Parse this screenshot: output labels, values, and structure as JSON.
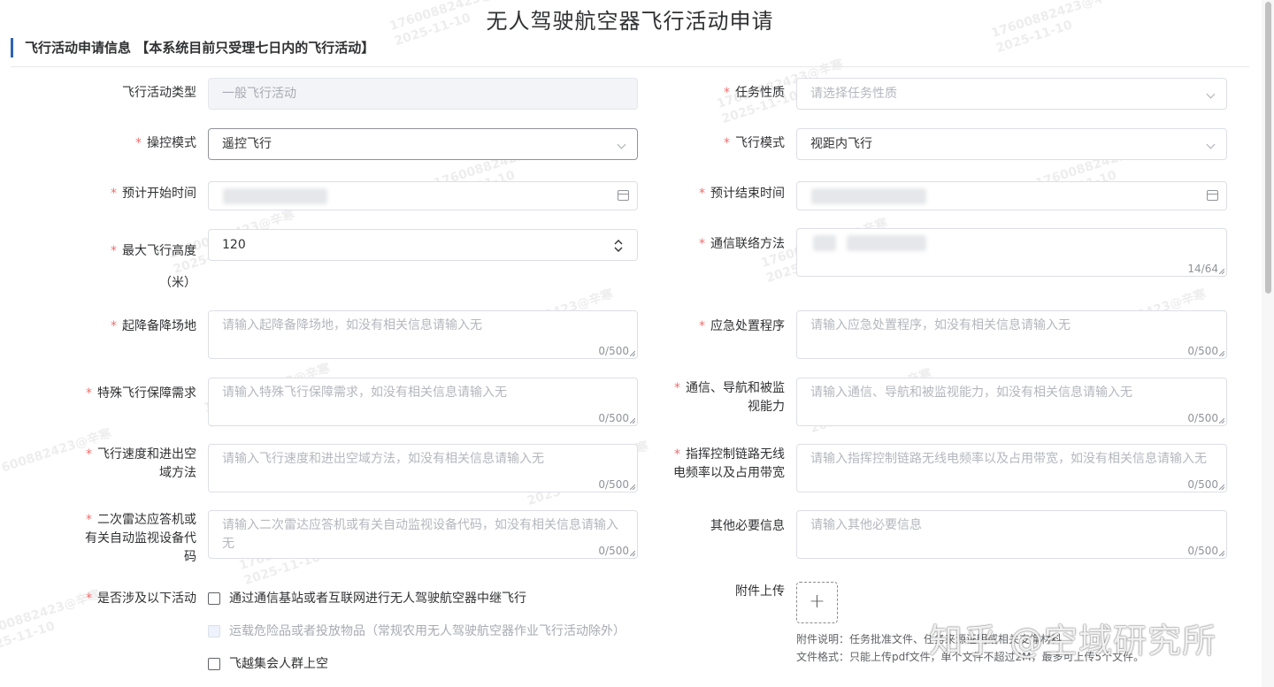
{
  "page_title": "无人驾驶航空器飞行活动申请",
  "section_title": "飞行活动申请信息 【本系统目前只受理七日内的飞行活动】",
  "fields": {
    "activity_type": {
      "label": "飞行活动类型",
      "value": "一般飞行活动"
    },
    "task_nature": {
      "label": "任务性质",
      "placeholder": "请选择任务性质"
    },
    "control_mode": {
      "label": "操控模式",
      "value": "遥控飞行"
    },
    "flight_mode": {
      "label": "飞行模式",
      "value": "视距内飞行"
    },
    "start_time": {
      "label": "预计开始时间"
    },
    "end_time": {
      "label": "预计结束时间"
    },
    "max_height": {
      "label": "最大飞行高度（米）",
      "value": "120"
    },
    "comm_method": {
      "label": "通信联络方法",
      "count": "14/64"
    },
    "takeoff_site": {
      "label": "起降备降场地",
      "placeholder": "请输入起降备降场地，如没有相关信息请输入无",
      "count": "0/500"
    },
    "emergency": {
      "label": "应急处置程序",
      "placeholder": "请输入应急处置程序，如没有相关信息请输入无",
      "count": "0/500"
    },
    "special_needs": {
      "label": "特殊飞行保障需求",
      "placeholder": "请输入特殊飞行保障需求，如没有相关信息请输入无",
      "count": "0/500"
    },
    "cns": {
      "label": "通信、导航和被监视能力",
      "placeholder": "请输入通信、导航和被监视能力，如没有相关信息请输入无",
      "count": "0/500"
    },
    "speed_airspace": {
      "label": "飞行速度和进出空域方法",
      "placeholder": "请输入飞行速度和进出空域方法，如没有相关信息请输入无",
      "count": "0/500"
    },
    "c2_link": {
      "label": "指挥控制链路无线电频率以及占用带宽",
      "placeholder": "请输入指挥控制链路无线电频率以及占用带宽，如没有相关信息请输入无",
      "count": "0/500"
    },
    "transponder": {
      "label": "二次雷达应答机或有关自动监视设备代码",
      "placeholder": "请输入二次雷达应答机或有关自动监视设备代码，如没有相关信息请输入无",
      "count": "0/500"
    },
    "other_info": {
      "label": "其他必要信息",
      "placeholder": "请输入其他必要信息",
      "count": "0/500"
    },
    "activities": {
      "label": "是否涉及以下活动",
      "options": [
        {
          "label": "通过通信基站或者互联网进行无人驾驶航空器中继飞行",
          "checked": false,
          "disabled": false
        },
        {
          "label": "运载危险品或者投放物品（常规农用无人驾驶航空器作业飞行活动除外）",
          "checked": false,
          "disabled": true
        },
        {
          "label": "飞越集会人群上空",
          "checked": false,
          "disabled": false
        }
      ]
    },
    "attachment": {
      "label": "附件上传",
      "plus": "+",
      "note": "附件说明：任务批准文件、任务来源证明或相关支撑材料",
      "format": "文件格式：只能上传pdf文件，单个文件不超过2M，最多可上传5个文件。"
    }
  },
  "watermark": {
    "id": "17600882423@辛寒",
    "date": "2025-11-10"
  },
  "brand_watermark": "知乎 @空域研究所",
  "icons": {
    "select": "chevron-down-icon",
    "date": "calendar-icon",
    "number": "spinner-icon",
    "upload": "plus-icon"
  },
  "colors": {
    "required": "#f56c6c",
    "accent": "#2f64b4",
    "border": "#dcdfe6",
    "placeholder": "#b4b7bd"
  }
}
